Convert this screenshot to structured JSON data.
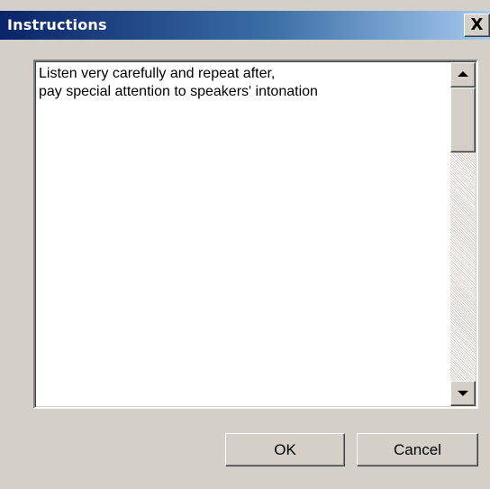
{
  "window": {
    "title": "Instructions",
    "close_glyph": "X"
  },
  "instructions": {
    "lines": [
      "Listen very carefully and repeat after,",
      "pay special attention to speakers' intonation"
    ]
  },
  "buttons": {
    "ok_label": "OK",
    "cancel_label": "Cancel"
  },
  "icons": {
    "scroll_up": "triangle-up",
    "scroll_down": "triangle-down",
    "close": "x-mark"
  },
  "colors": {
    "titlebar_start": "#0a246a",
    "titlebar_end": "#a6caf0",
    "dialog_face": "#d4d0c8"
  }
}
